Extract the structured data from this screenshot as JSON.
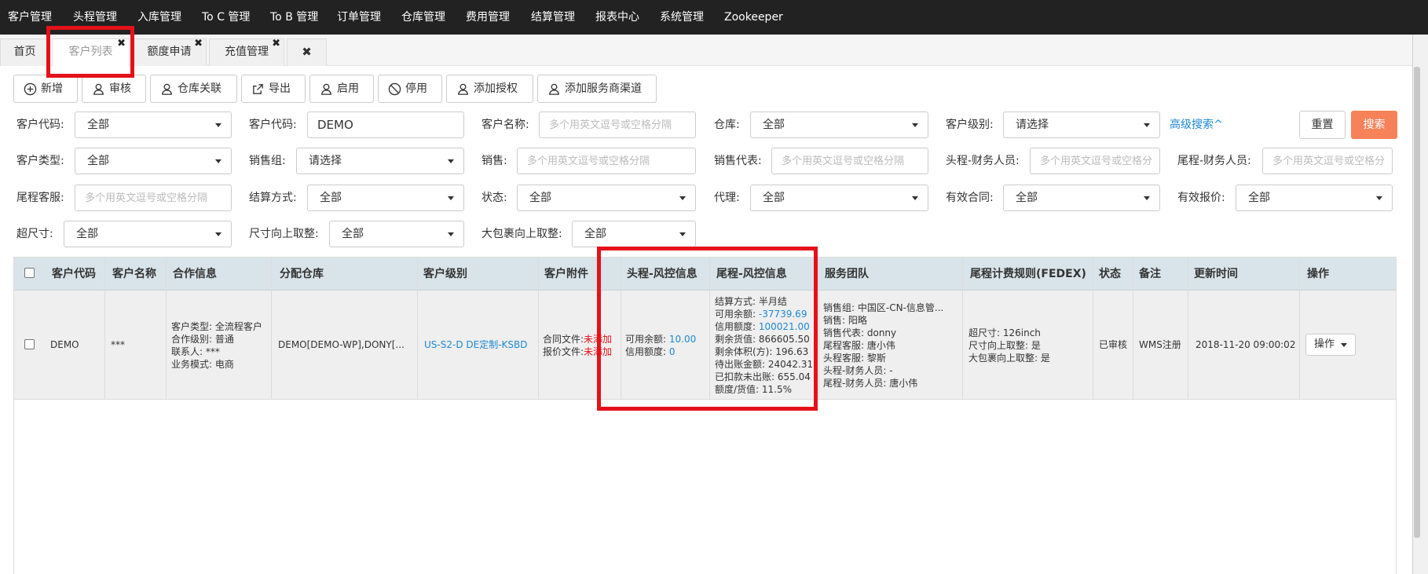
{
  "top_nav": [
    "客户管理",
    "头程管理",
    "入库管理",
    "To C 管理",
    "To B 管理",
    "订单管理",
    "仓库管理",
    "费用管理",
    "结算管理",
    "报表中心",
    "系统管理",
    "Zookeeper"
  ],
  "tabs": {
    "home": "首页",
    "customer_list": "客户列表",
    "credit_apply": "额度申请",
    "recharge": "充值管理",
    "close_glyph": "✖"
  },
  "toolbar": {
    "add": "新增",
    "audit": "审核",
    "warehouse_link": "仓库关联",
    "export": "导出",
    "enable": "启用",
    "disable": "停用",
    "add_auth": "添加授权",
    "add_channel": "添加服务商渠道"
  },
  "filters": {
    "customer_code_1": {
      "label": "客户代码:",
      "value": "全部"
    },
    "customer_code_2": {
      "label": "客户代码:",
      "value": "DEMO"
    },
    "customer_name": {
      "label": "客户名称:",
      "placeholder": "多个用英文逗号或空格分隔"
    },
    "warehouse": {
      "label": "仓库:",
      "value": "全部"
    },
    "customer_level": {
      "label": "客户级别:",
      "value": "请选择"
    },
    "advanced": "高级搜索^",
    "reset": "重置",
    "search": "搜索",
    "customer_type": {
      "label": "客户类型:",
      "value": "全部"
    },
    "sales_group": {
      "label": "销售组:",
      "value": "请选择"
    },
    "sales": {
      "label": "销售:",
      "placeholder": "多个用英文逗号或空格分隔"
    },
    "sales_rep": {
      "label": "销售代表:",
      "placeholder": "多个用英文逗号或空格分隔"
    },
    "head_finance": {
      "label": "头程-财务人员:",
      "placeholder": "多个用英文逗号或空格分"
    },
    "tail_finance": {
      "label": "尾程-财务人员:",
      "placeholder": "多个用英文逗号或空格分"
    },
    "tail_cs": {
      "label": "尾程客服:",
      "placeholder": "多个用英文逗号或空格分隔"
    },
    "settle_method": {
      "label": "结算方式:",
      "value": "全部"
    },
    "status": {
      "label": "状态:",
      "value": "全部"
    },
    "agent": {
      "label": "代理:",
      "value": "全部"
    },
    "valid_contract": {
      "label": "有效合同:",
      "value": "全部"
    },
    "valid_quote": {
      "label": "有效报价:",
      "value": "全部"
    },
    "oversize": {
      "label": "超尺寸:",
      "value": "全部"
    },
    "size_roundup": {
      "label": "尺寸向上取整:",
      "value": "全部"
    },
    "big_pack_roundup": {
      "label": "大包裹向上取整:",
      "value": "全部"
    }
  },
  "table": {
    "headers": [
      "客户代码",
      "客户名称",
      "合作信息",
      "分配仓库",
      "客户级别",
      "客户附件",
      "头程-风控信息",
      "尾程-风控信息",
      "服务团队",
      "尾程计费规则(FEDEX)",
      "状态",
      "备注",
      "更新时间",
      "操作"
    ],
    "row": {
      "code": "DEMO",
      "name": "***",
      "coop": [
        "客户类型: 全流程客户",
        "合作级别: 普通",
        "联系人: ***",
        "业务模式: 电商"
      ],
      "warehouse": "DEMO[DEMO-WP],DONY[...",
      "level": "US-S2-D DE定制-KSBD",
      "attach": [
        {
          "label": "合同文件:",
          "value": "未添加"
        },
        {
          "label": "报价文件:",
          "value": "未添加"
        }
      ],
      "head_risk": [
        {
          "label": "可用余额: ",
          "value": "10.00"
        },
        {
          "label": "信用额度: ",
          "value": "0"
        }
      ],
      "tail_risk": [
        {
          "label": "结算方式: ",
          "value": "半月结",
          "blue": false
        },
        {
          "label": "可用余额: ",
          "value": "-37739.69",
          "blue": true
        },
        {
          "label": "信用额度: ",
          "value": "100021.00",
          "blue": true
        },
        {
          "label": "剩余货值: ",
          "value": "866605.50",
          "blue": false
        },
        {
          "label": "剩余体积(方): ",
          "value": "196.63",
          "blue": false
        },
        {
          "label": "待出账金额: ",
          "value": "24042.31",
          "blue": false
        },
        {
          "label": "已扣款未出账: ",
          "value": "655.04",
          "blue": false
        },
        {
          "label": "额度/货值: ",
          "value": "11.5%",
          "blue": false
        }
      ],
      "team": [
        "销售组: 中国区-CN-信息管...",
        "销售: 阳略",
        "销售代表: donny",
        "尾程客服: 唐小伟",
        "头程客服: 黎斯",
        "头程-财务人员: -",
        "尾程-财务人员: 唐小伟"
      ],
      "fedex": [
        "超尺寸: 126inch",
        "尺寸向上取整: 是",
        "大包裹向上取整: 是"
      ],
      "status": "已审核",
      "remark": "WMS注册",
      "updated": "2018-11-20 09:00:02",
      "action": "操作"
    }
  },
  "colors": {
    "accent_red": "#e4111a",
    "link_blue": "#1e88d5",
    "search_orange": "#f6825a",
    "nav_bg": "#222222",
    "header_bg": "#d9e4ea"
  }
}
